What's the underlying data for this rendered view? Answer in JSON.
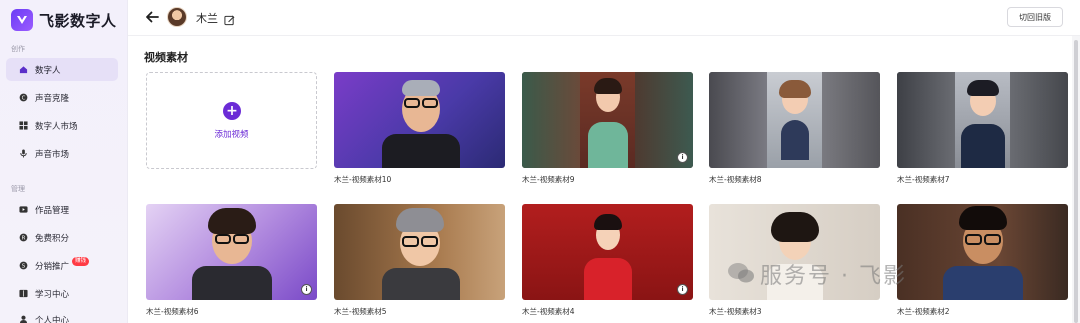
{
  "app": {
    "name": "飞影数字人",
    "accent": "#6b2bd6"
  },
  "sidebar": {
    "sections": [
      {
        "label": "创作"
      },
      {
        "label": "管理"
      }
    ],
    "items": [
      {
        "label": "数字人",
        "icon": "home-icon",
        "active": true
      },
      {
        "label": "声音克隆",
        "icon": "voice-clone-icon"
      },
      {
        "label": "数字人市场",
        "icon": "grid-icon"
      },
      {
        "label": "声音市场",
        "icon": "microphone-icon"
      },
      {
        "label": "作品管理",
        "icon": "video-icon"
      },
      {
        "label": "免费积分",
        "icon": "points-icon"
      },
      {
        "label": "分销推广",
        "icon": "share-icon",
        "badge": "赚钱"
      },
      {
        "label": "学习中心",
        "icon": "book-icon"
      },
      {
        "label": "个人中心",
        "icon": "user-icon"
      }
    ]
  },
  "header": {
    "user_name": "木兰",
    "old_version_label": "切回旧版"
  },
  "main": {
    "section_title": "视频素材",
    "add_label": "添加视频",
    "videos": [
      {
        "title": "木兰-视频素材10"
      },
      {
        "title": "木兰-视频素材9"
      },
      {
        "title": "木兰-视频素材8"
      },
      {
        "title": "木兰-视频素材7"
      },
      {
        "title": "木兰-视频素材6"
      },
      {
        "title": "木兰-视频素材5"
      },
      {
        "title": "木兰-视频素材4"
      },
      {
        "title": "木兰-视频素材3"
      },
      {
        "title": "木兰-视频素材2"
      }
    ]
  },
  "watermark": {
    "text": "服务号 · 飞影"
  }
}
